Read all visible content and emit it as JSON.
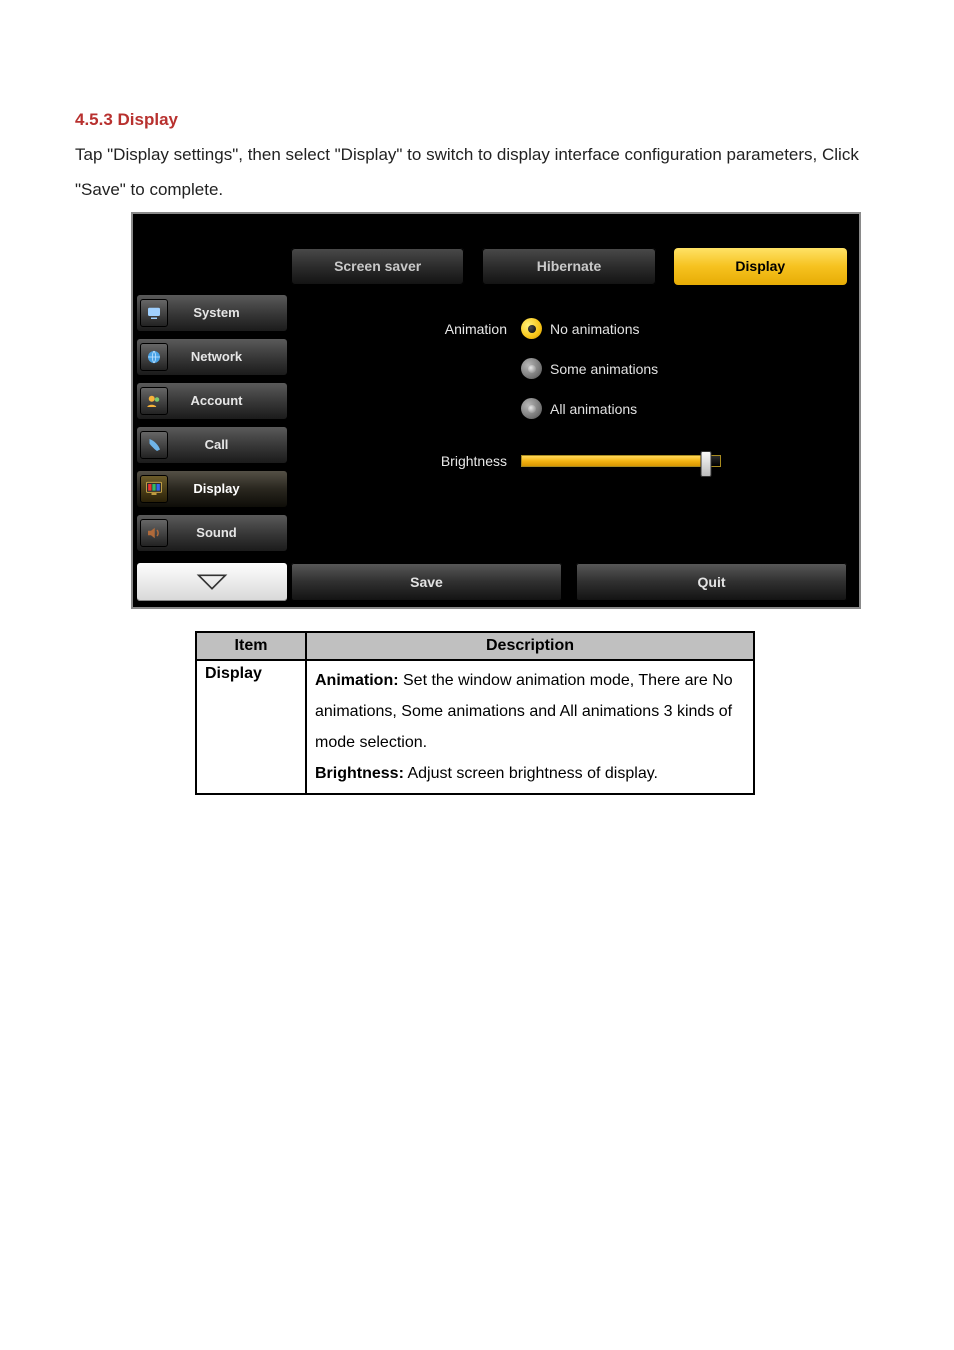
{
  "heading": "4.5.3 Display",
  "intro": "Tap \"Display settings\", then select \"Display\" to switch to display interface configuration parameters, Click \"Save\" to complete.",
  "device": {
    "tabs": {
      "screensaver": "Screen saver",
      "hibernate": "Hibernate",
      "display": "Display"
    },
    "sidebar": {
      "system": "System",
      "network": "Network",
      "account": "Account",
      "call": "Call",
      "display": "Display",
      "sound": "Sound"
    },
    "settings": {
      "animation_label": "Animation",
      "radios": {
        "none": "No animations",
        "some": "Some animations",
        "all": "All animations"
      },
      "brightness_label": "Brightness"
    },
    "buttons": {
      "save": "Save",
      "quit": "Quit"
    }
  },
  "table": {
    "head_item": "Item",
    "head_desc": "Description",
    "row_item": "Display",
    "desc_anim_label": "Animation:",
    "desc_anim_text": " Set the window animation mode, There are No animations, Some animations and All animations 3 kinds of mode selection.",
    "desc_bright_label": "Brightness:",
    "desc_bright_text": " Adjust screen brightness of display."
  }
}
